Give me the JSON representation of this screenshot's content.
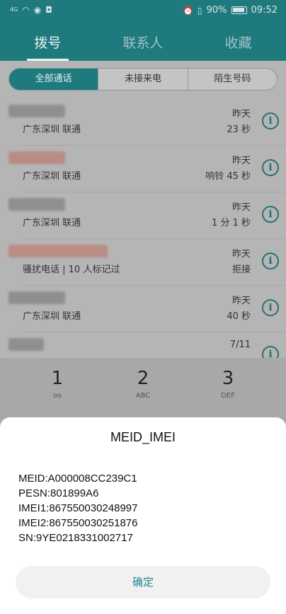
{
  "status_bar": {
    "signal": "4G",
    "battery_percent": "90%",
    "time": "09:52"
  },
  "tabs": [
    {
      "label": "拨号",
      "active": true
    },
    {
      "label": "联系人",
      "active": false
    },
    {
      "label": "收藏",
      "active": false
    }
  ],
  "filter": {
    "items": [
      "全部通话",
      "未接来电",
      "陌生号码"
    ],
    "selected": "全部通话"
  },
  "calls": [
    {
      "location": "广东深圳 联通",
      "day": "昨天",
      "detail": "23 秒"
    },
    {
      "location": "广东深圳 联通",
      "day": "昨天",
      "detail": "响铃 45 秒"
    },
    {
      "location": "广东深圳 联通",
      "day": "昨天",
      "detail": "1 分 1 秒"
    },
    {
      "location": "骚扰电话 | 10 人标记过",
      "day": "昨天",
      "detail": "拒接"
    },
    {
      "location": "广东深圳 联通",
      "day": "昨天",
      "detail": "40 秒"
    },
    {
      "location": "",
      "day": "7/11",
      "detail": ""
    }
  ],
  "dialpad": {
    "keys": [
      {
        "digit": "1",
        "letters": "ᴏᴏ"
      },
      {
        "digit": "2",
        "letters": "ABC"
      },
      {
        "digit": "3",
        "letters": "DEF"
      }
    ]
  },
  "dialog": {
    "title": "MEID_IMEI",
    "lines": [
      "MEID:A000008CC239C1",
      "PESN:801899A6",
      "IMEI1:867550030248997",
      "IMEI2:867550030251876",
      "SN:9YE0218331002717"
    ],
    "ok_label": "确定"
  },
  "colors": {
    "accent": "#1f8a8e",
    "header": "#1f7a7e"
  }
}
